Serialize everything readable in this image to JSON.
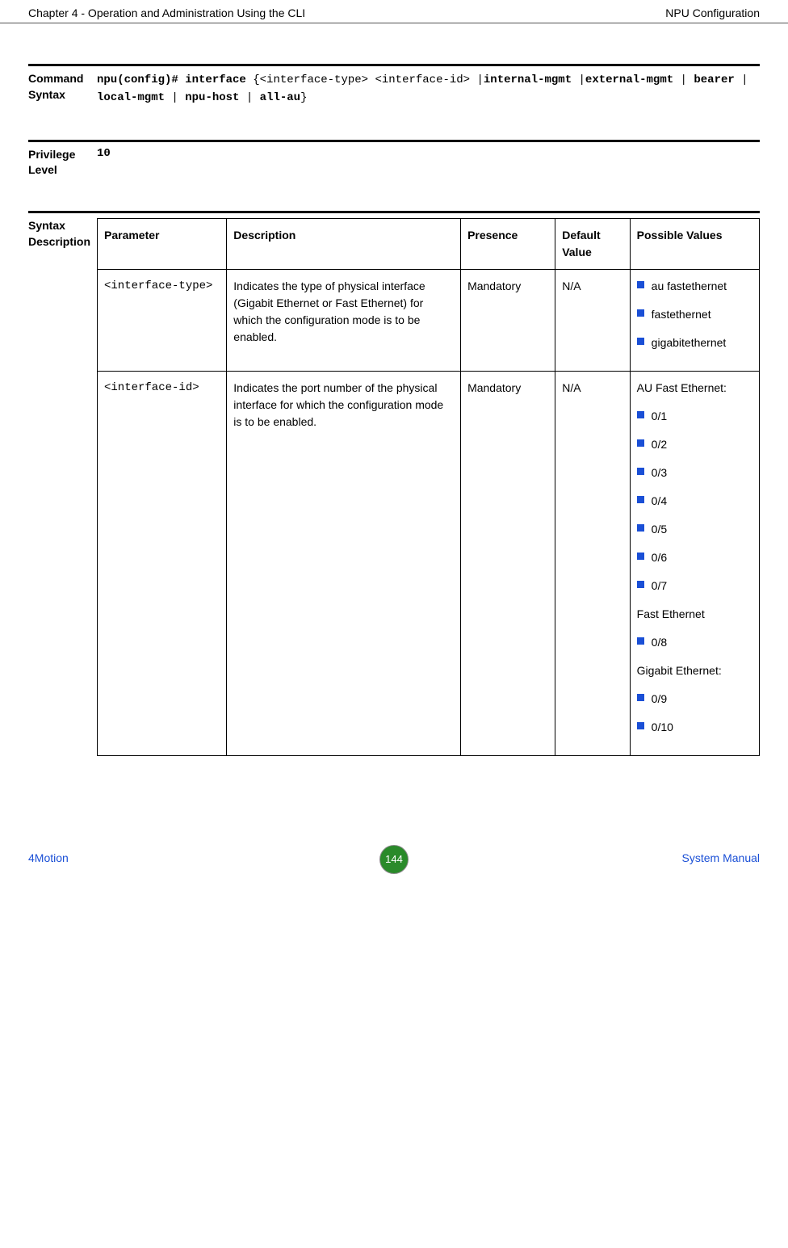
{
  "header": {
    "left": "Chapter 4 - Operation and Administration Using the CLI",
    "right": "NPU Configuration"
  },
  "commandSyntax": {
    "label": "Command Syntax",
    "parts": {
      "p1": "npu(config)# interface ",
      "p2": "{<interface-type> <interface-id> |",
      "p3": "internal-mgmt",
      "p4": " |",
      "p5": "external-mgmt",
      "p6": " | ",
      "p7": "bearer",
      "p8": " | ",
      "p9": "local-mgmt",
      "p10": " | ",
      "p11": "npu-host",
      "p12": " | ",
      "p13": "all-au",
      "p14": "}"
    }
  },
  "privilege": {
    "label": "Privilege Level",
    "value": "10"
  },
  "syntax": {
    "label": "Syntax Description",
    "headers": {
      "parameter": "Parameter",
      "description": "Description",
      "presence": "Presence",
      "default": "Default Value",
      "possible": "Possible Values"
    },
    "rows": [
      {
        "parameter": "<interface-type>",
        "description": "Indicates the type of physical interface (Gigabit Ethernet or Fast Ethernet) for which the configuration mode is to be enabled.",
        "presence": "Mandatory",
        "default": "N/A",
        "values": {
          "items": [
            "au fastethernet",
            "fastethernet",
            "gigabitethernet"
          ]
        }
      },
      {
        "parameter": "<interface-id>",
        "description": "Indicates the port number of the physical interface for which the configuration mode is to be enabled.",
        "presence": "Mandatory",
        "default": "N/A",
        "values": {
          "group1_label": "AU Fast Ethernet:",
          "group1": [
            "0/1",
            "0/2",
            "0/3",
            "0/4",
            "0/5",
            "0/6",
            "0/7"
          ],
          "group2_label": "Fast Ethernet",
          "group2": [
            "0/8"
          ],
          "group3_label": "Gigabit Ethernet:",
          "group3": [
            "0/9",
            "0/10"
          ]
        }
      }
    ]
  },
  "footer": {
    "left": "4Motion",
    "pageNumber": "144",
    "right": "System Manual"
  }
}
